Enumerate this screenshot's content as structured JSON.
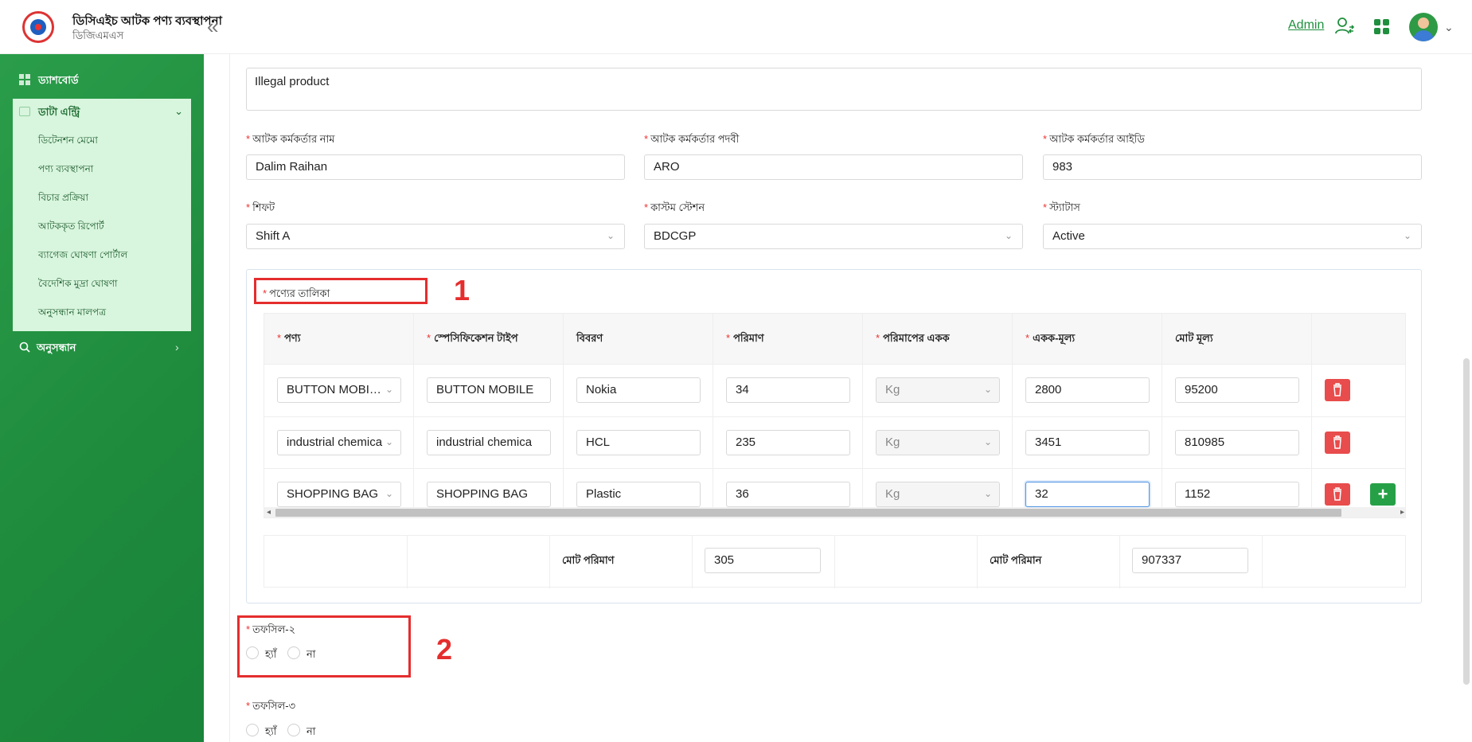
{
  "header": {
    "app_title": "ডিসিএইচ আটক পণ্য ব্যবস্থাপনা",
    "app_subtitle": "ডিজিএমএস",
    "user_name": "Admin"
  },
  "sidebar": {
    "dashboard": "ড্যাশবোর্ড",
    "data_entry": "ডাটা এন্ট্রি",
    "submenu": [
      "ডিটেনশন মেমো",
      "পণ্য ব্যবস্থাপনা",
      "বিচার প্রক্রিয়া",
      "আটককৃত রিপোর্ট",
      "ব্যাগেজ ঘোষণা পোর্টাল",
      "বৈদেশিক মুদ্রা ঘোষণা",
      "অনুসন্ধান মালপত্র"
    ],
    "search": "অনুসন্ধান"
  },
  "form": {
    "description_value": "Illegal product",
    "officer_name_label": "আটক কর্মকর্তার নাম",
    "officer_name_value": "Dalim Raihan",
    "officer_designation_label": "আটক কর্মকর্তার পদবী",
    "officer_designation_value": "ARO",
    "officer_id_label": "আটক কর্মকর্তার আইডি",
    "officer_id_value": "983",
    "shift_label": "শিফট",
    "shift_value": "Shift A",
    "station_label": "কাস্টম স্টেশন",
    "station_value": "BDCGP",
    "status_label": "স্ট্যাটাস",
    "status_value": "Active"
  },
  "product_list": {
    "label": "পণ্যের তালিকা",
    "columns": [
      "পণ্য",
      "স্পেসিফিকেশন টাইপ",
      "বিবরণ",
      "পরিমাণ",
      "পরিমাপের একক",
      "একক-মূল্য",
      "মোট মূল্য"
    ],
    "rows": [
      {
        "product": "BUTTON MOBILE",
        "spec": "BUTTON MOBILE",
        "desc": "Nokia",
        "qty": "34",
        "unit": "Kg",
        "unit_price": "2800",
        "total": "95200"
      },
      {
        "product": "industrial chemica",
        "spec": "industrial chemica",
        "desc": "HCL",
        "qty": "235",
        "unit": "Kg",
        "unit_price": "3451",
        "total": "810985"
      },
      {
        "product": "SHOPPING BAG",
        "spec": "SHOPPING BAG",
        "desc": "Plastic",
        "qty": "36",
        "unit": "Kg",
        "unit_price": "32",
        "total": "1152"
      }
    ],
    "total_qty_label": "মোট পরিমাণ",
    "total_qty_value": "305",
    "total_amount_label": "মোট পরিমান",
    "total_amount_value": "907337"
  },
  "annotations": {
    "box1": "1",
    "box2": "2"
  },
  "tofsil2": {
    "label": "তফসিল-২",
    "yes": "হ্যাঁ",
    "no": "না"
  },
  "tofsil3": {
    "label": "তফসিল-৩",
    "yes": "হ্যাঁ",
    "no": "না"
  },
  "colors": {
    "brand_green": "#1f8f3e",
    "danger": "#e84c4c",
    "highlight": "#e52d2d"
  }
}
